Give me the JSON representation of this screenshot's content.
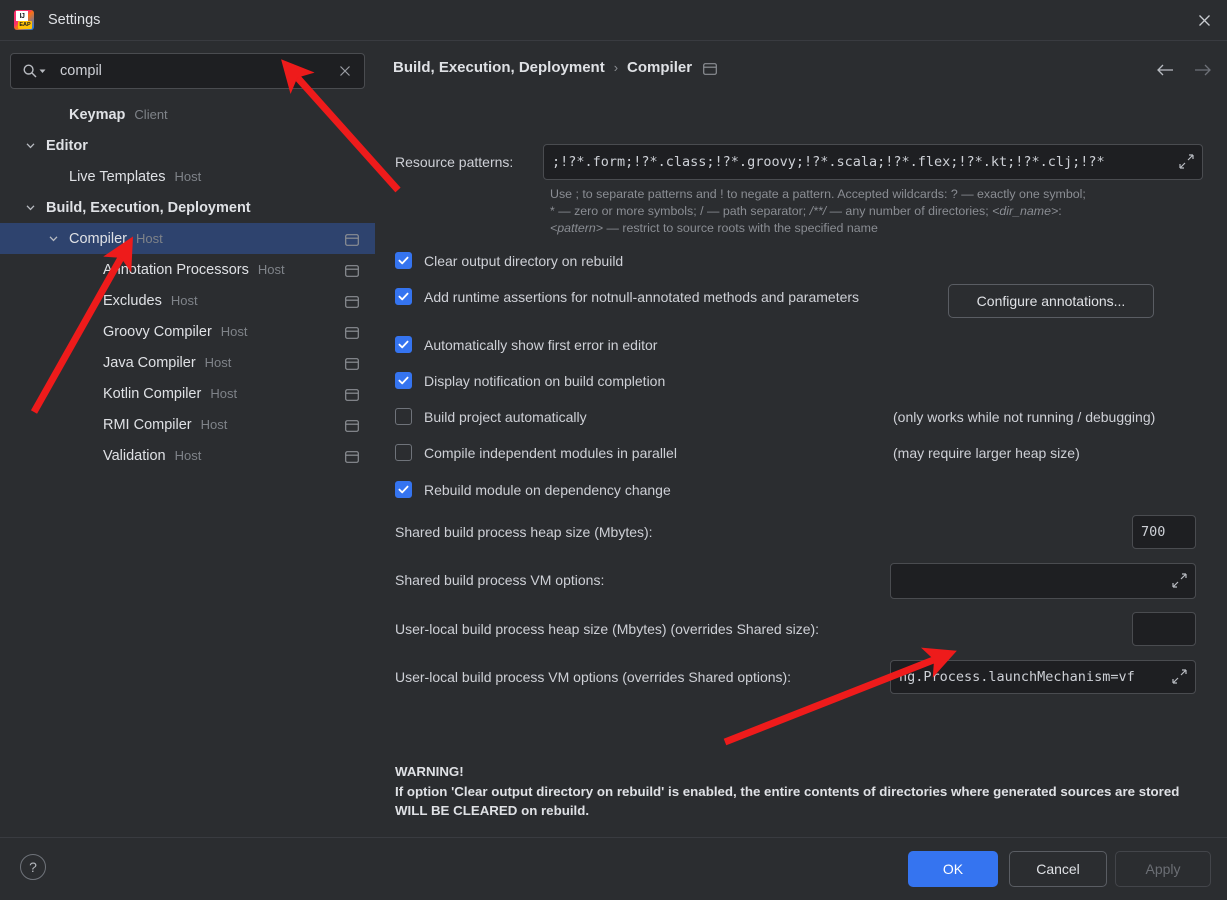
{
  "window": {
    "title": "Settings",
    "app_icon": "intellij-idea-eap-icon",
    "close_label": "×"
  },
  "search": {
    "value": "compil",
    "placeholder": "",
    "icon": "search-icon",
    "clear_icon": "close-icon"
  },
  "sidebar": {
    "items": [
      {
        "label": "Keymap",
        "tag": "Client",
        "depth": 1,
        "bold": true,
        "twisty": "none",
        "badge": false,
        "selected": false
      },
      {
        "label": "Editor",
        "tag": "",
        "depth": 0,
        "bold": true,
        "twisty": "expanded",
        "badge": false,
        "selected": false
      },
      {
        "label": "Live Templates",
        "tag": "Host",
        "depth": 1,
        "bold": false,
        "twisty": "none",
        "badge": false,
        "selected": false
      },
      {
        "label": "Build, Execution, Deployment",
        "tag": "",
        "depth": 0,
        "bold": true,
        "twisty": "expanded",
        "badge": false,
        "selected": false
      },
      {
        "label": "Compiler",
        "tag": "Host",
        "depth": 1,
        "bold": false,
        "twisty": "expanded",
        "badge": true,
        "selected": true
      },
      {
        "label": "Annotation Processors",
        "tag": "Host",
        "depth": 2,
        "bold": false,
        "twisty": "none",
        "badge": true,
        "selected": false
      },
      {
        "label": "Excludes",
        "tag": "Host",
        "depth": 2,
        "bold": false,
        "twisty": "none",
        "badge": true,
        "selected": false
      },
      {
        "label": "Groovy Compiler",
        "tag": "Host",
        "depth": 2,
        "bold": false,
        "twisty": "none",
        "badge": true,
        "selected": false
      },
      {
        "label": "Java Compiler",
        "tag": "Host",
        "depth": 2,
        "bold": false,
        "twisty": "none",
        "badge": true,
        "selected": false
      },
      {
        "label": "Kotlin Compiler",
        "tag": "Host",
        "depth": 2,
        "bold": false,
        "twisty": "none",
        "badge": true,
        "selected": false
      },
      {
        "label": "RMI Compiler",
        "tag": "Host",
        "depth": 2,
        "bold": false,
        "twisty": "none",
        "badge": true,
        "selected": false
      },
      {
        "label": "Validation",
        "tag": "Host",
        "depth": 2,
        "bold": false,
        "twisty": "none",
        "badge": true,
        "selected": false
      }
    ]
  },
  "breadcrumb": {
    "parent": "Build, Execution, Deployment",
    "separator": "›",
    "current": "Compiler",
    "badge": "host-badge-icon"
  },
  "nav": {
    "back_icon": "arrow-left-icon",
    "forward_icon": "arrow-right-icon"
  },
  "main": {
    "resource_patterns": {
      "label": "Resource patterns:",
      "value": ";!?*.form;!?*.class;!?*.groovy;!?*.scala;!?*.flex;!?*.kt;!?*.clj;!?*",
      "expand_icon": "expand-icon"
    },
    "hint_line1": "Use ; to separate patterns and ! to negate a pattern. Accepted wildcards:   ? — exactly one symbol;",
    "hint_line2_a": "* — zero or more symbols;  / — path separator;  ",
    "hint_line2_b": "/**/",
    "hint_line2_c": "  — any number of directories;  ",
    "hint_line2_d": "<dir_name>",
    "hint_line2_e": ":",
    "hint_line3_a": "<pattern>",
    "hint_line3_b": "  — restrict to source roots with the specified name",
    "checkboxes": [
      {
        "label": "Clear output directory on rebuild",
        "checked": true,
        "note": ""
      },
      {
        "label": "Add runtime assertions for notnull-annotated methods and parameters",
        "checked": true,
        "note": ""
      },
      {
        "label": "Automatically show first error in editor",
        "checked": true,
        "note": ""
      },
      {
        "label": "Display notification on build completion",
        "checked": true,
        "note": ""
      },
      {
        "label": "Build project automatically",
        "checked": false,
        "note": "(only works while not running / debugging)"
      },
      {
        "label": "Compile independent modules in parallel",
        "checked": false,
        "note": "(may require larger heap size)"
      },
      {
        "label": "Rebuild module on dependency change",
        "checked": true,
        "note": ""
      }
    ],
    "configure_annotations_button": "Configure annotations...",
    "fields": [
      {
        "label": "Shared build process heap size (Mbytes):",
        "value": "700",
        "expandable": false
      },
      {
        "label": "Shared build process VM options:",
        "value": "",
        "expandable": true
      },
      {
        "label": "User-local build process heap size (Mbytes) (overrides Shared size):",
        "value": "",
        "expandable": false
      },
      {
        "label": "User-local build process VM options (overrides Shared options):",
        "value": "ng.Process.launchMechanism=vf",
        "expandable": true
      }
    ],
    "warning_title": "WARNING!",
    "warning_body": "If option 'Clear output directory on rebuild' is enabled, the entire contents of directories where generated sources are stored WILL BE CLEARED on rebuild."
  },
  "footer": {
    "help_label": "?",
    "ok_label": "OK",
    "cancel_label": "Cancel",
    "apply_label": "Apply"
  },
  "colors": {
    "accent": "#3574f0",
    "selection": "#2e436e",
    "background": "#2b2d30",
    "field_background": "#1e1f22",
    "annotation_arrow": "#ee1b1b"
  }
}
